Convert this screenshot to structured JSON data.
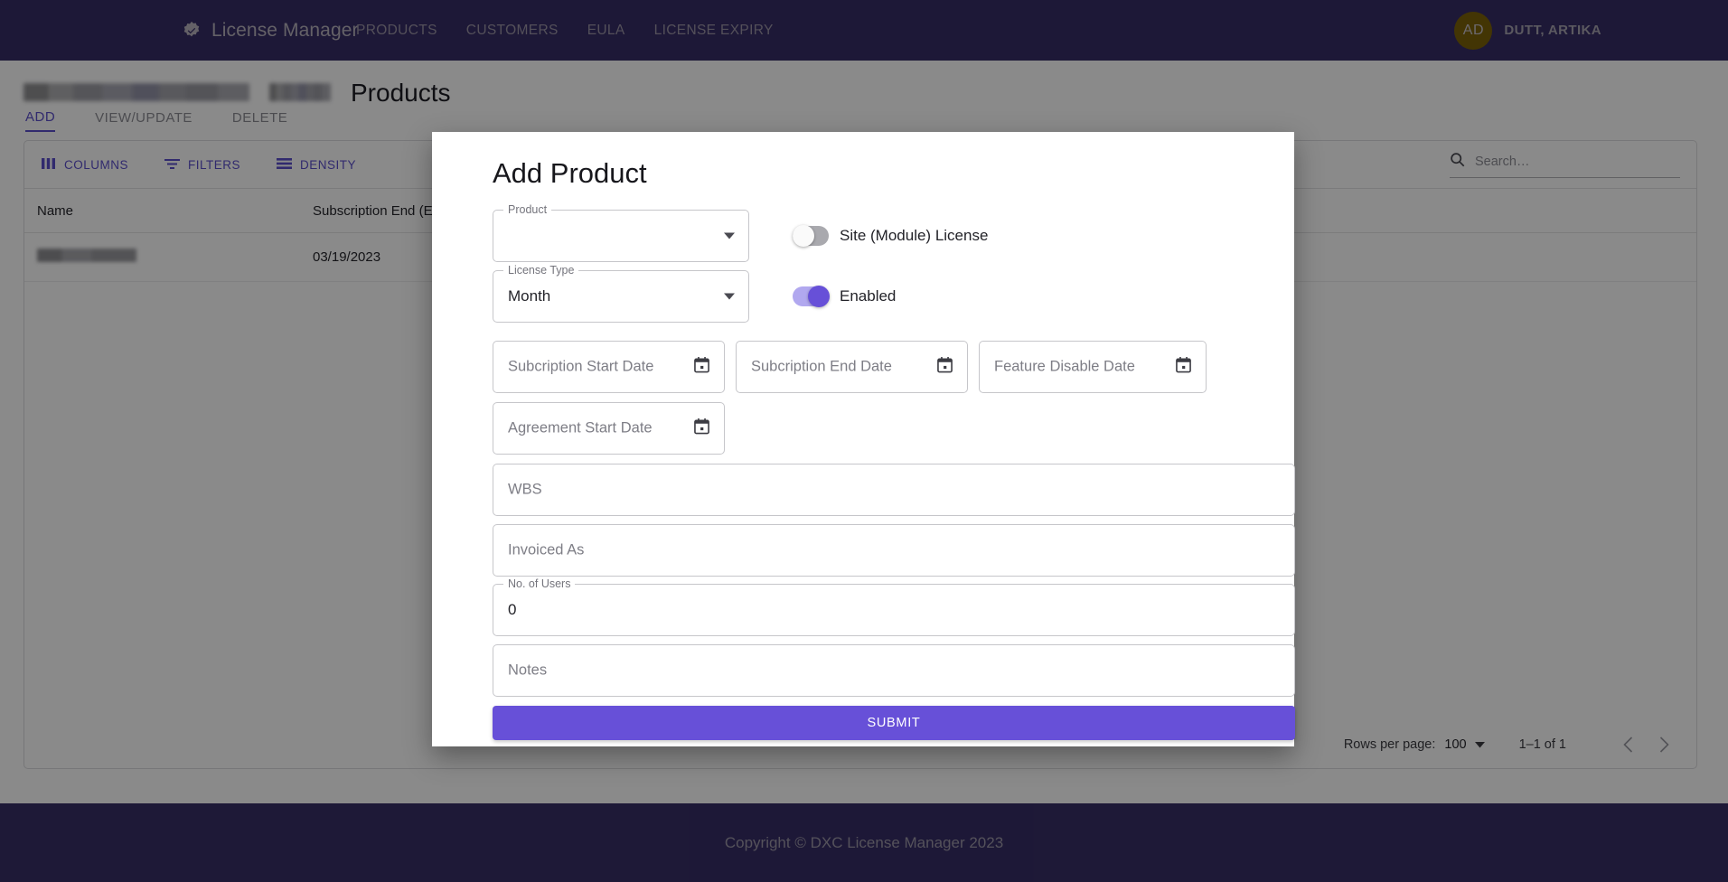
{
  "nav": {
    "brand": "License Manager",
    "brand_icon": "verified-badge-icon",
    "links": [
      "PRODUCTS",
      "CUSTOMERS",
      "EULA",
      "LICENSE EXPIRY"
    ],
    "user": {
      "initials": "AD",
      "name": "DUTT, ARTIKA"
    }
  },
  "page": {
    "title": "Products",
    "tabs": [
      {
        "label": "ADD",
        "active": true
      },
      {
        "label": "VIEW/UPDATE",
        "active": false
      },
      {
        "label": "DELETE",
        "active": false
      }
    ],
    "toolbar": {
      "columns": "COLUMNS",
      "filters": "FILTERS",
      "density": "DENSITY",
      "search_placeholder": "Search…"
    },
    "grid": {
      "columns": [
        "Name",
        "Subscription End (Exp"
      ],
      "rows": [
        {
          "name": "",
          "subscription_end": "03/19/2023"
        }
      ]
    },
    "pagination": {
      "rows_per_page_label": "Rows per page:",
      "rows_per_page_value": "100",
      "range": "1–1 of 1",
      "prev_icon": "chevron-left-icon",
      "next_icon": "chevron-right-icon"
    }
  },
  "modal": {
    "title": "Add Product",
    "product": {
      "label": "Product",
      "value": ""
    },
    "site_license": {
      "label": "Site (Module) License",
      "state": "off"
    },
    "license_type": {
      "label": "License Type",
      "value": "Month"
    },
    "enabled": {
      "label": "Enabled",
      "state": "on"
    },
    "dates": [
      {
        "placeholder": "Subcription Start Date",
        "value": ""
      },
      {
        "placeholder": "Subcription End Date",
        "value": ""
      },
      {
        "placeholder": "Feature Disable Date",
        "value": ""
      }
    ],
    "agreement_start": {
      "placeholder": "Agreement Start Date",
      "value": ""
    },
    "wbs": {
      "placeholder": "WBS",
      "value": ""
    },
    "invoiced_as": {
      "placeholder": "Invoiced As",
      "value": ""
    },
    "no_of_users": {
      "label": "No. of Users",
      "value": "0"
    },
    "notes": {
      "placeholder": "Notes",
      "value": ""
    },
    "submit_label": "SUBMIT"
  },
  "footer": {
    "copyright": "Copyright © DXC License Manager 2023"
  },
  "colors": {
    "nav_bg": "#372e66",
    "accent": "#5b4ecb",
    "primary": "#6750d8",
    "avatar_bg": "#7d6308"
  }
}
